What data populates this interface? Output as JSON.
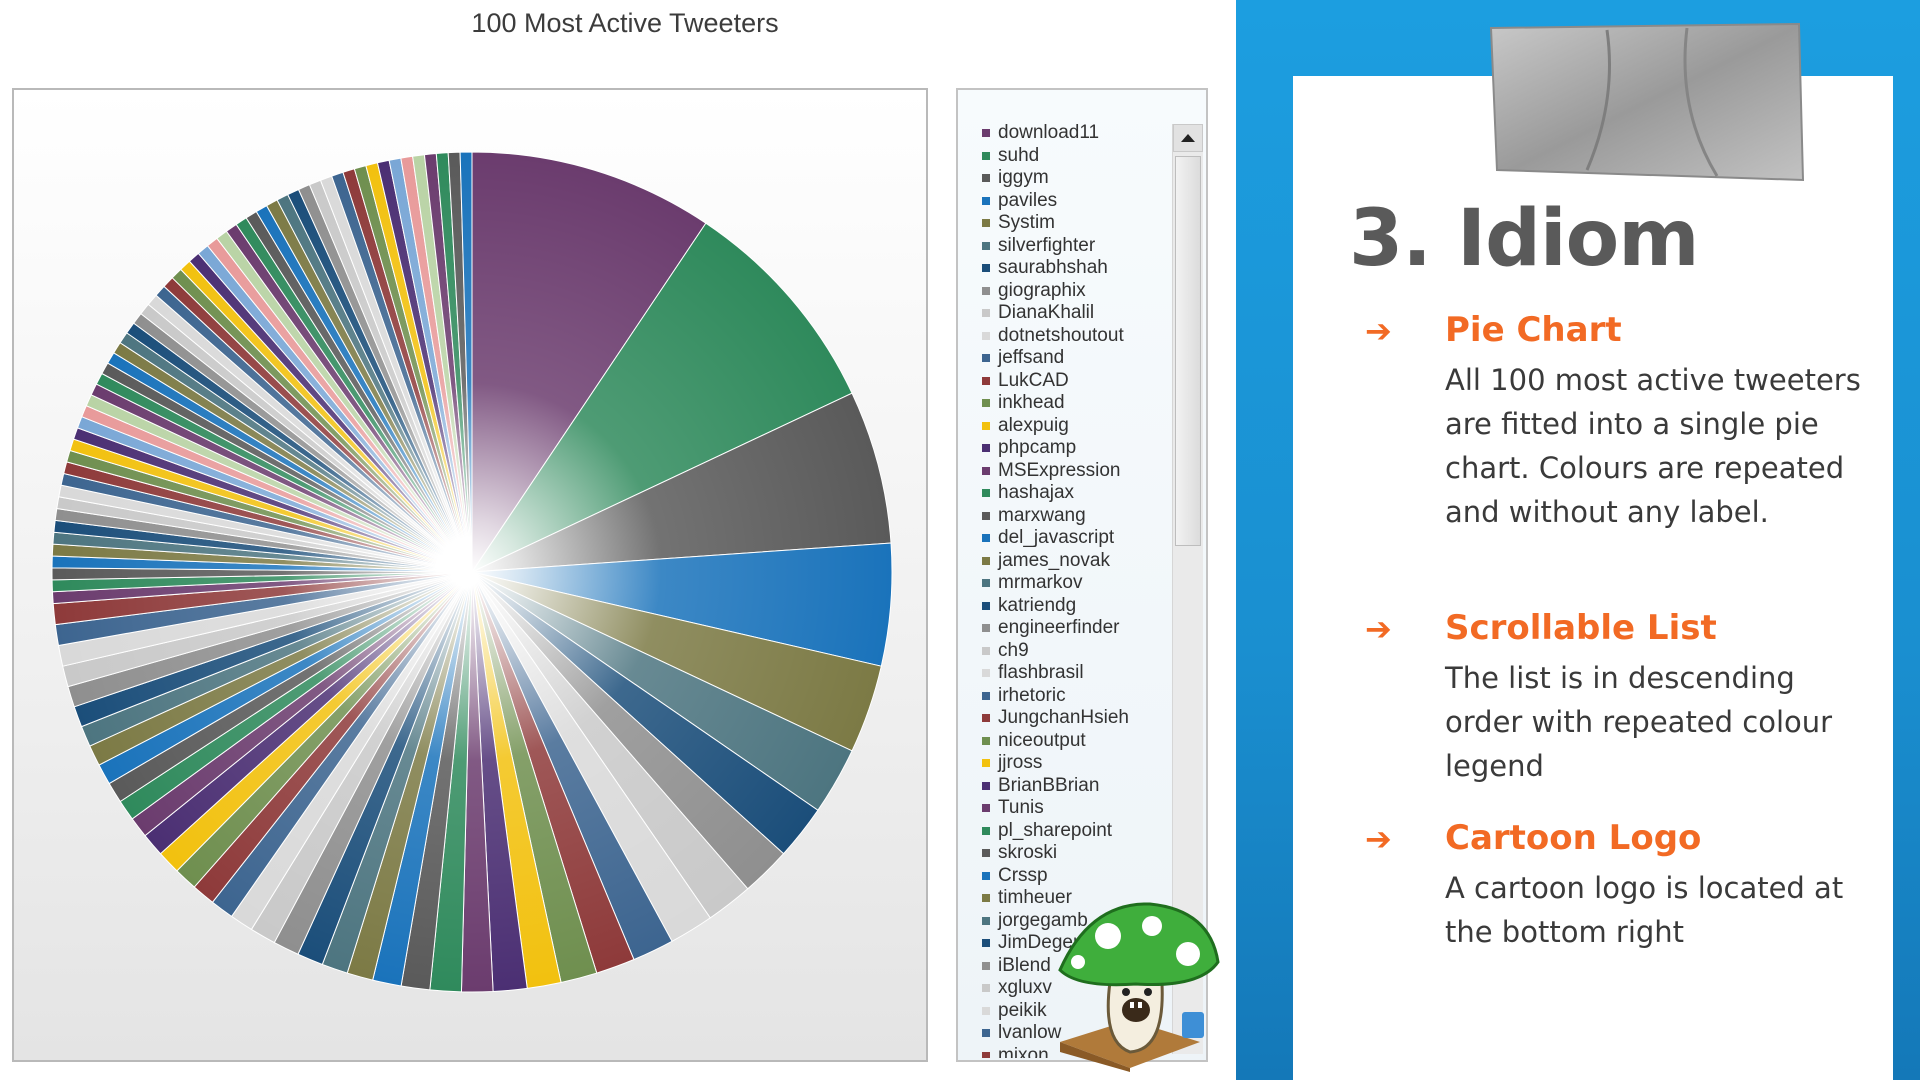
{
  "chart_data": {
    "type": "pie",
    "title": "100 Most Active Tweeters",
    "legend_position": "right",
    "legend_scrollable": true,
    "series": [
      {
        "name": "download11",
        "value": 9.4,
        "color": "#6b3c6e"
      },
      {
        "name": "suhd",
        "value": 8.6,
        "color": "#2f8a5c"
      },
      {
        "name": "iggym",
        "value": 5.9,
        "color": "#5a5a5a"
      },
      {
        "name": "paviles",
        "value": 4.7,
        "color": "#1a73bb"
      },
      {
        "name": "Systim",
        "value": 3.4,
        "color": "#7c7a45"
      },
      {
        "name": "silverfighter",
        "value": 2.6,
        "color": "#4d7580"
      },
      {
        "name": "saurabhshah",
        "value": 2.1,
        "color": "#1b4e7a"
      },
      {
        "name": "giographix",
        "value": 1.9,
        "color": "#8f8f8f"
      },
      {
        "name": "DianaKhalil",
        "value": 1.8,
        "color": "#c9c9c9"
      },
      {
        "name": "dotnetshoutout",
        "value": 1.7,
        "color": "#d9d9d9"
      },
      {
        "name": "jeffsand",
        "value": 1.6,
        "color": "#3d6590"
      },
      {
        "name": "LukCAD",
        "value": 1.5,
        "color": "#8e3a3a"
      },
      {
        "name": "inkhead",
        "value": 1.4,
        "color": "#6f8f4f"
      },
      {
        "name": "alexpuig",
        "value": 1.3,
        "color": "#f2c10f"
      },
      {
        "name": "phpcamp",
        "value": 1.3,
        "color": "#4b2f73"
      },
      {
        "name": "MSExpression",
        "value": 1.2,
        "color": "#6b3c6e"
      },
      {
        "name": "hashajax",
        "value": 1.2,
        "color": "#2f8a5c"
      },
      {
        "name": "marxwang",
        "value": 1.1,
        "color": "#5a5a5a"
      },
      {
        "name": "del_javascript",
        "value": 1.1,
        "color": "#1a73bb"
      },
      {
        "name": "james_novak",
        "value": 1.0,
        "color": "#7c7a45"
      },
      {
        "name": "mrmarkov",
        "value": 1.0,
        "color": "#4d7580"
      },
      {
        "name": "katriendg",
        "value": 1.0,
        "color": "#1b4e7a"
      },
      {
        "name": "engineerfinder",
        "value": 1.0,
        "color": "#8f8f8f"
      },
      {
        "name": "ch9",
        "value": 1.0,
        "color": "#c9c9c9"
      },
      {
        "name": "flashbrasil",
        "value": 0.9,
        "color": "#d9d9d9"
      },
      {
        "name": "irhetoric",
        "value": 0.9,
        "color": "#3d6590"
      },
      {
        "name": "JungchanHsieh",
        "value": 0.9,
        "color": "#8e3a3a"
      },
      {
        "name": "niceoutput",
        "value": 0.9,
        "color": "#6f8f4f"
      },
      {
        "name": "jjross",
        "value": 0.9,
        "color": "#f2c10f"
      },
      {
        "name": "BrianBBrian",
        "value": 0.9,
        "color": "#4b2f73"
      },
      {
        "name": "Tunis",
        "value": 0.8,
        "color": "#6b3c6e"
      },
      {
        "name": "pl_sharepoint",
        "value": 0.8,
        "color": "#2f8a5c"
      },
      {
        "name": "skroski",
        "value": 0.8,
        "color": "#5a5a5a"
      },
      {
        "name": "Crssp",
        "value": 0.8,
        "color": "#1a73bb"
      },
      {
        "name": "timheuer",
        "value": 0.8,
        "color": "#7c7a45"
      },
      {
        "name": "jorgegamb",
        "value": 0.8,
        "color": "#4d7580"
      },
      {
        "name": "JimDeger",
        "value": 0.8,
        "color": "#1b4e7a"
      },
      {
        "name": "iBlend",
        "value": 0.8,
        "color": "#8f8f8f"
      },
      {
        "name": "xgluxv",
        "value": 0.8,
        "color": "#c9c9c9"
      },
      {
        "name": "peikik",
        "value": 0.8,
        "color": "#d9d9d9"
      },
      {
        "name": "lvanlow",
        "value": 0.8,
        "color": "#3d6590"
      },
      {
        "name": "mixon",
        "value": 0.8,
        "color": "#8e3a3a"
      }
    ]
  },
  "panel": {
    "title": "3. Idiom",
    "points": [
      {
        "arrow": "➔",
        "heading": "Pie Chart",
        "body": "All 100 most active tweeters are fitted into a single pie chart. Colours are repeated and without any label."
      },
      {
        "arrow": "➔",
        "heading": "Scrollable List",
        "body": "The list is in descending order with repeated colour legend"
      },
      {
        "arrow": "➔",
        "heading": "Cartoon Logo",
        "body": "A cartoon logo is located at the bottom right"
      }
    ]
  },
  "scrollbar": {
    "up_icon": "triangle-up"
  }
}
